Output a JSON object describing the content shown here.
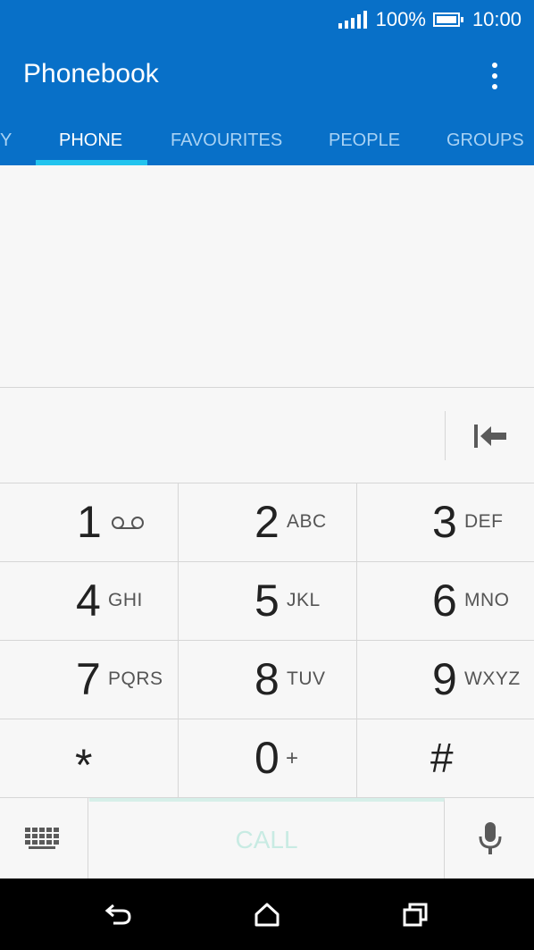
{
  "status_bar": {
    "battery_text": "100%",
    "battery_level": 1.0,
    "time": "10:00",
    "signal_bars": 5
  },
  "app_bar": {
    "title": "Phonebook"
  },
  "tabs": [
    {
      "label": "Y",
      "active": false
    },
    {
      "label": "PHONE",
      "active": true
    },
    {
      "label": "FAVOURITES",
      "active": false
    },
    {
      "label": "PEOPLE",
      "active": false
    },
    {
      "label": "GROUPS",
      "active": false
    }
  ],
  "number_field": {
    "value": ""
  },
  "keypad": [
    {
      "digit": "1",
      "letters": ""
    },
    {
      "digit": "2",
      "letters": "ABC"
    },
    {
      "digit": "3",
      "letters": "DEF"
    },
    {
      "digit": "4",
      "letters": "GHI"
    },
    {
      "digit": "5",
      "letters": "JKL"
    },
    {
      "digit": "6",
      "letters": "MNO"
    },
    {
      "digit": "7",
      "letters": "PQRS"
    },
    {
      "digit": "8",
      "letters": "TUV"
    },
    {
      "digit": "9",
      "letters": "WXYZ"
    },
    {
      "digit": "*",
      "letters": ""
    },
    {
      "digit": "0",
      "letters": "+"
    },
    {
      "digit": "#",
      "letters": ""
    }
  ],
  "bottom_actions": {
    "call_label": "CALL"
  },
  "icons": {
    "backspace": "backspace-icon",
    "voicemail": "voicemail-icon",
    "keyboard": "keyboard-icon",
    "mic": "microphone-icon",
    "back": "back-icon",
    "home": "home-icon",
    "recents": "recents-icon",
    "overflow": "more-vert-icon"
  },
  "colors": {
    "app_bar": "#0870c8",
    "tab_indicator": "#22c3ee",
    "call_text": "#c8ebe3"
  }
}
